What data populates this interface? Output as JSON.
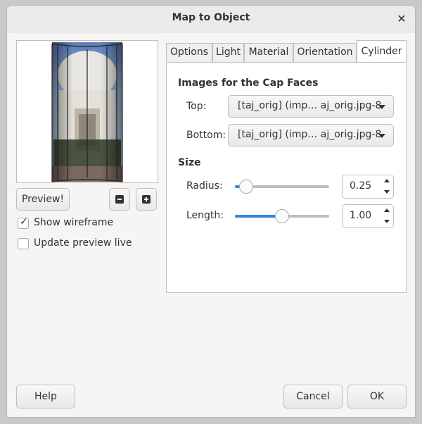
{
  "window": {
    "title": "Map to Object",
    "close_glyph": "✕"
  },
  "preview": {
    "button_label": "Preview!",
    "zoom_out_icon": "zoom-out-icon",
    "zoom_in_icon": "zoom-in-icon",
    "show_wireframe": {
      "label": "Show wireframe",
      "checked": true,
      "mark": "✓"
    },
    "update_live": {
      "label": "Update preview live",
      "checked": false
    }
  },
  "tabs": [
    {
      "label": "Options",
      "active": false
    },
    {
      "label": "Light",
      "active": false
    },
    {
      "label": "Material",
      "active": false
    },
    {
      "label": "Orientation",
      "active": false
    },
    {
      "label": "Cylinder",
      "active": true
    }
  ],
  "cylinder": {
    "cap_title": "Images for the Cap Faces",
    "top": {
      "label": "Top:",
      "value": "[taj_orig] (imp… aj_orig.jpg-8"
    },
    "bottom": {
      "label": "Bottom:",
      "value": "[taj_orig] (imp… aj_orig.jpg-8"
    },
    "size_title": "Size",
    "radius": {
      "label": "Radius:",
      "value": "0.25",
      "fraction": 0.12
    },
    "length": {
      "label": "Length:",
      "value": "1.00",
      "fraction": 0.5
    }
  },
  "actions": {
    "help": "Help",
    "cancel": "Cancel",
    "ok": "OK"
  },
  "colors": {
    "accent": "#3584e4",
    "background": "#f6f5f4"
  }
}
